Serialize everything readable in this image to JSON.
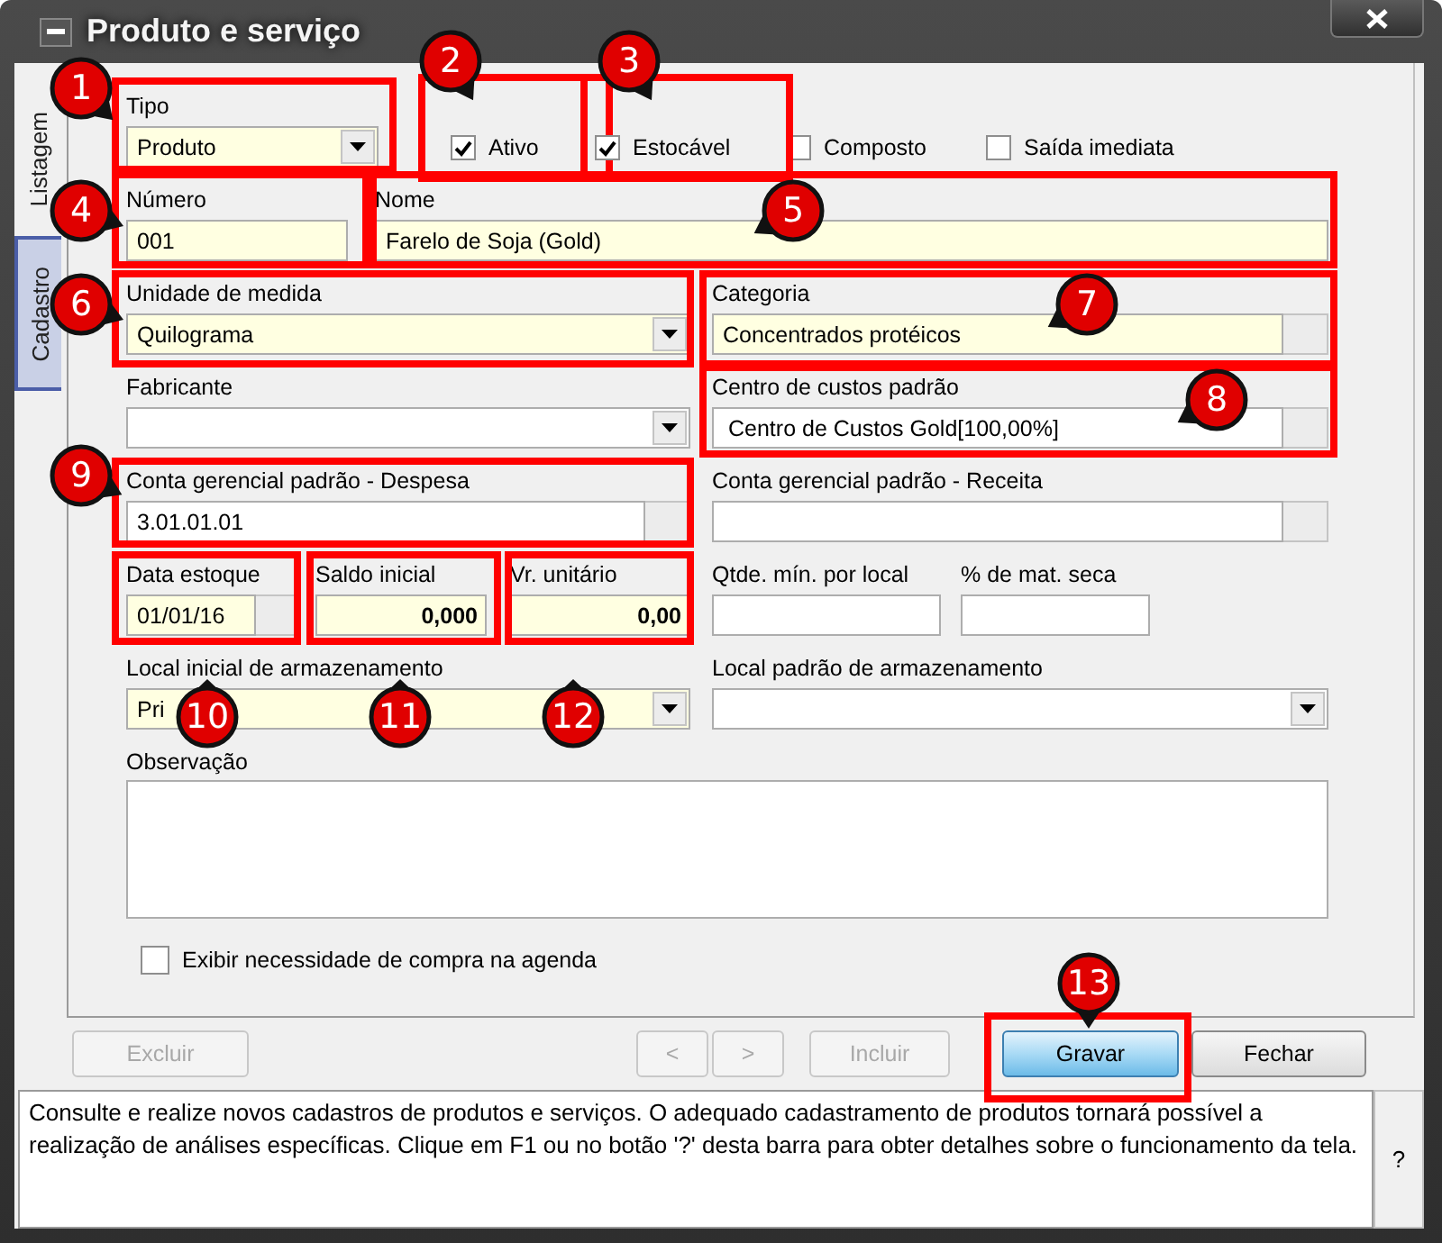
{
  "window": {
    "title": "Produto e serviço"
  },
  "side_tabs": [
    {
      "label": "Listagem",
      "selected": false
    },
    {
      "label": "Cadastro",
      "selected": true
    }
  ],
  "tipo": {
    "label": "Tipo",
    "value": "Produto",
    "required": true,
    "callout": "1"
  },
  "flags": [
    {
      "label": "Ativo",
      "checked": true,
      "callout": "2"
    },
    {
      "label": "Estocável",
      "checked": true,
      "callout": "3"
    },
    {
      "label": "Composto",
      "checked": false
    },
    {
      "label": "Saída imediata",
      "checked": false
    }
  ],
  "rows": [
    {
      "fields": [
        {
          "kind": "text",
          "label": "Número",
          "value": "001",
          "required": true,
          "callout": "4"
        },
        {
          "kind": "text",
          "label": "Nome",
          "value": "Farelo de Soja (Gold)",
          "required": true,
          "callout": "5"
        }
      ]
    },
    {
      "fields": [
        {
          "kind": "combo",
          "label": "Unidade de medida",
          "value": "Quilograma",
          "required": true,
          "callout": "6"
        },
        {
          "kind": "lookup",
          "label": "Categoria",
          "value": "Concentrados protéicos",
          "required": true,
          "callout": "7"
        }
      ]
    },
    {
      "fields": [
        {
          "kind": "combo",
          "label": "Fabricante",
          "required": false
        },
        {
          "kind": "lookup",
          "label": "Centro de custos padrão",
          "value": "Centro  de  Custos  Gold[100,00%]",
          "required": false,
          "callout": "8"
        }
      ]
    },
    {
      "fields": [
        {
          "kind": "lookup",
          "label": "Conta gerencial padrão - Despesa",
          "value": "3.01.01.01",
          "required": false,
          "callout": "9"
        },
        {
          "kind": "lookup",
          "label": "Conta gerencial padrão - Receita",
          "required": false
        }
      ]
    },
    {
      "fields": [
        {
          "kind": "date",
          "label": "Data estoque",
          "value": "01/01/16",
          "required": true,
          "callout": "10"
        },
        {
          "kind": "number",
          "label": "Saldo inicial",
          "value": "0,000",
          "required": true,
          "callout": "11"
        },
        {
          "kind": "number",
          "label": "Vr. unitário",
          "value": "0,00",
          "required": true,
          "callout": "12"
        },
        {
          "kind": "text",
          "label": "Qtde. mín. por local",
          "required": false
        },
        {
          "kind": "text",
          "label": "% de mat. seca",
          "required": false
        }
      ]
    },
    {
      "fields": [
        {
          "kind": "combo",
          "label": "Local inicial de armazenamento",
          "value": "Pri",
          "required": true
        },
        {
          "kind": "combo",
          "label": "Local padrão de armazenamento",
          "required": false
        }
      ]
    }
  ],
  "observacao": {
    "label": "Observação"
  },
  "exibir": {
    "label": "Exibir necessidade de compra na agenda",
    "checked": false
  },
  "buttons": [
    {
      "label": "Excluir",
      "disabled": true,
      "default": false
    },
    {
      "label": "<",
      "disabled": true,
      "default": false
    },
    {
      "label": ">",
      "disabled": true,
      "default": false
    },
    {
      "label": "Incluir",
      "disabled": true,
      "default": false
    },
    {
      "label": "Gravar",
      "disabled": false,
      "default": true,
      "callout": "13"
    },
    {
      "label": "Fechar",
      "disabled": false,
      "default": false
    }
  ],
  "help": {
    "text": "Consulte e realize novos cadastros de produtos e serviços. O adequado cadastramento de produtos tornará possível a realização de análises específicas. Clique em F1 ou no botão '?' desta barra para obter detalhes sobre o funcionamento da tela.",
    "button": "?"
  }
}
